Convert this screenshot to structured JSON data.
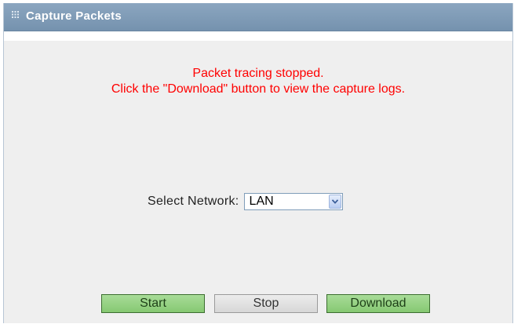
{
  "header": {
    "title": "Capture Packets",
    "icon": "grip-icon"
  },
  "status": {
    "line1": "Packet tracing stopped.",
    "line2": "Click the \"Download\" button to view the capture logs.",
    "color": "#ff0000"
  },
  "network": {
    "label": "Select Network:",
    "selected": "LAN",
    "icon": "chevron-down-icon"
  },
  "buttons": {
    "start": "Start",
    "stop": "Stop",
    "download": "Download"
  },
  "colors": {
    "header": "#7e9ab5",
    "button_active": "#96d284",
    "button_inactive": "#e0e0e0"
  }
}
